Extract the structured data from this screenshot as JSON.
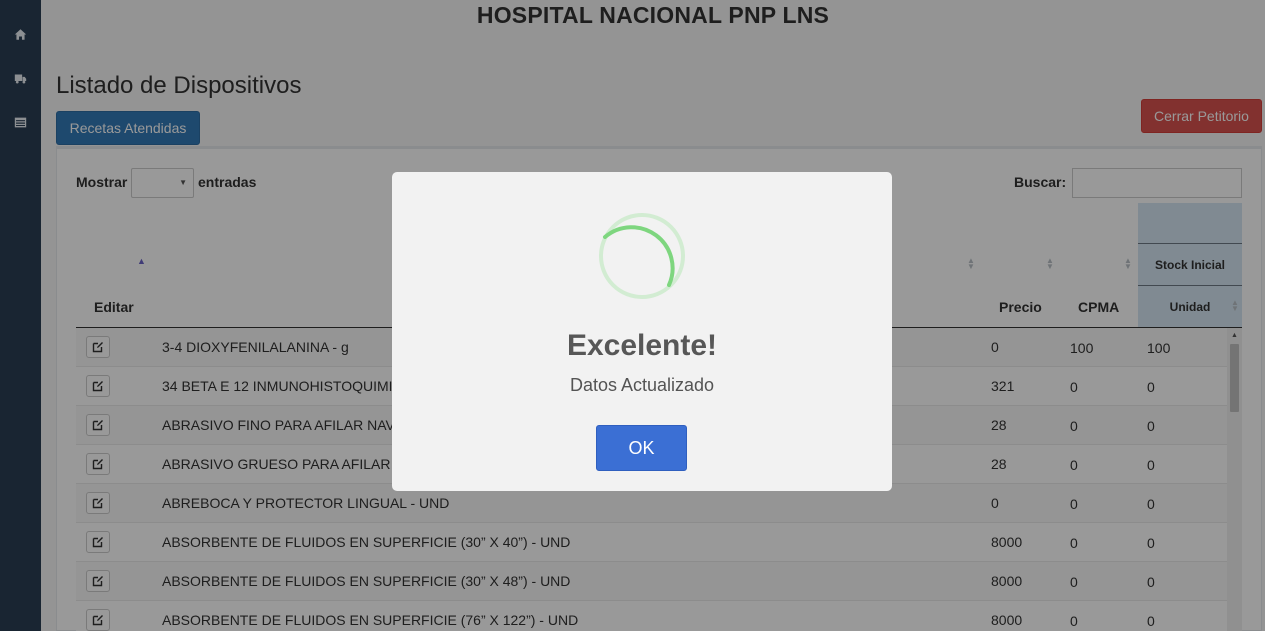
{
  "header": {
    "title": "HOSPITAL NACIONAL PNP LNS"
  },
  "page": {
    "title": "Listado de Dispositivos",
    "recetas_label": "Recetas Atendidas",
    "cerrar_label": "Cerrar Petitorio"
  },
  "sidebar": {
    "icons": [
      "home-icon",
      "truck-icon",
      "list-icon"
    ]
  },
  "table_controls": {
    "mostrar_label": "Mostrar",
    "length_value": "",
    "entradas_label": "entradas",
    "buscar_label": "Buscar:",
    "search_value": ""
  },
  "table": {
    "headers": {
      "editar": "Editar",
      "precio": "Precio",
      "cpma": "CPMA",
      "stock_group": "Stock Inicial",
      "unidad": "Unidad"
    },
    "rows": [
      {
        "name": "3-4 DIOXYFENILALANINA - g",
        "precio": "0",
        "cpma": "100",
        "stock": "100"
      },
      {
        "name": "34 BETA E 12 INMUNOHISTOQUIMI",
        "precio": "321",
        "cpma": "0",
        "stock": "0"
      },
      {
        "name": "ABRASIVO FINO PARA AFILAR NAV",
        "precio": "28",
        "cpma": "0",
        "stock": "0"
      },
      {
        "name": "ABRASIVO GRUESO PARA AFILAR",
        "precio": "28",
        "cpma": "0",
        "stock": "0"
      },
      {
        "name": "ABREBOCA Y PROTECTOR LINGUAL - UND",
        "precio": "0",
        "cpma": "0",
        "stock": "0"
      },
      {
        "name": "ABSORBENTE DE FLUIDOS EN SUPERFICIE (30” X 40”) - UND",
        "precio": "8000",
        "cpma": "0",
        "stock": "0"
      },
      {
        "name": "ABSORBENTE DE FLUIDOS EN SUPERFICIE (30” X 48”) - UND",
        "precio": "8000",
        "cpma": "0",
        "stock": "0"
      },
      {
        "name": "ABSORBENTE DE FLUIDOS EN SUPERFICIE (76” X 122”) - UND",
        "precio": "8000",
        "cpma": "0",
        "stock": "0"
      }
    ]
  },
  "modal": {
    "title": "Excelente!",
    "text": "Datos Actualizado",
    "ok_label": "OK",
    "colors": {
      "spinner": "#7ed67f",
      "ok_button": "#3b6fd4"
    }
  },
  "colors": {
    "sidebar": "#2a3f54",
    "primary_button": "#337ab7",
    "danger_button": "#d9534f",
    "stock_header": "#d6e7f3"
  }
}
